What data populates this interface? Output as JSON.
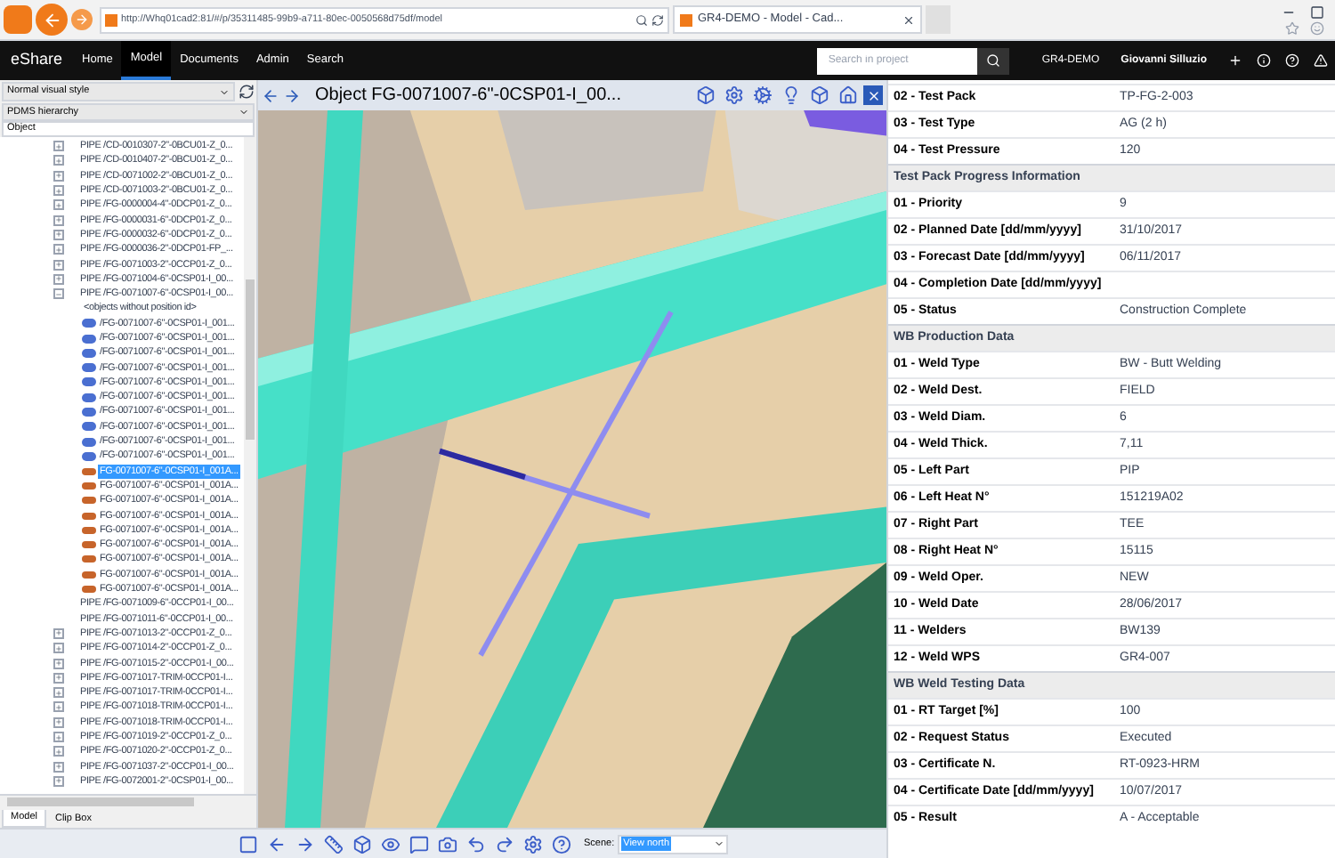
{
  "browser": {
    "url": "http://Whq01cad2:81/#/p/35311485-99b9-a711-80ec-0050568d75df/model",
    "tab_title": "GR4-DEMO - Model - Cad..."
  },
  "nav": {
    "brand": "eShare",
    "items": [
      {
        "label": "Home",
        "selected": false
      },
      {
        "label": "Model",
        "selected": true
      },
      {
        "label": "Documents",
        "selected": false
      },
      {
        "label": "Admin",
        "selected": false
      },
      {
        "label": "Search",
        "selected": false
      }
    ],
    "search": {
      "placeholder": "Search in project"
    },
    "project": "GR4-DEMO",
    "user": "Giovanni Silluzio"
  },
  "left_panel": {
    "visual_style": "Normal visual style",
    "hierarchy": "PDMS hierarchy",
    "column": "Object",
    "tree": [
      {
        "kind": "pipe",
        "label": "PIPE /CD-0010307-2\"-0BCU01-Z_0...",
        "expanded": false
      },
      {
        "kind": "pipe",
        "label": "PIPE /CD-0010407-2\"-0BCU01-Z_0...",
        "expanded": false
      },
      {
        "kind": "pipe",
        "label": "PIPE /CD-0071002-2\"-0BCU01-Z_0...",
        "expanded": false
      },
      {
        "kind": "pipe",
        "label": "PIPE /CD-0071003-2\"-0BCU01-Z_0...",
        "expanded": false
      },
      {
        "kind": "pipe",
        "label": "PIPE /FG-0000004-4\"-0DCP01-Z_0...",
        "expanded": false
      },
      {
        "kind": "pipe",
        "label": "PIPE /FG-0000031-6\"-0DCP01-Z_0...",
        "expanded": false
      },
      {
        "kind": "pipe",
        "label": "PIPE /FG-0000032-6\"-0DCP01-Z_0...",
        "expanded": false
      },
      {
        "kind": "pipe",
        "label": "PIPE /FG-0000036-2\"-0DCP01-FP_...",
        "expanded": false
      },
      {
        "kind": "pipe",
        "label": "PIPE /FG-0071003-2\"-0CCP01-Z_0...",
        "expanded": false
      },
      {
        "kind": "pipe",
        "label": "PIPE /FG-0071004-6\"-0CSP01-I_00...",
        "expanded": false
      },
      {
        "kind": "pipe",
        "label": "PIPE /FG-0071007-6\"-0CSP01-I_00...",
        "expanded": true,
        "children": [
          {
            "kind": "note",
            "label": "<objects without position id>",
            "selected": false
          },
          {
            "kind": "part",
            "label": "/FG-0071007-6\"-0CSP01-I_001...",
            "selected": false
          },
          {
            "kind": "part",
            "label": "/FG-0071007-6\"-0CSP01-I_001...",
            "selected": false
          },
          {
            "kind": "part",
            "label": "/FG-0071007-6\"-0CSP01-I_001...",
            "selected": false
          },
          {
            "kind": "part",
            "label": "/FG-0071007-6\"-0CSP01-I_001...",
            "selected": false
          },
          {
            "kind": "part",
            "label": "/FG-0071007-6\"-0CSP01-I_001...",
            "selected": false
          },
          {
            "kind": "part",
            "label": "/FG-0071007-6\"-0CSP01-I_001...",
            "selected": false
          },
          {
            "kind": "part",
            "label": "/FG-0071007-6\"-0CSP01-I_001...",
            "selected": false
          },
          {
            "kind": "part",
            "label": "/FG-0071007-6\"-0CSP01-I_001...",
            "selected": false
          },
          {
            "kind": "part",
            "label": "/FG-0071007-6\"-0CSP01-I_001...",
            "selected": false
          },
          {
            "kind": "part",
            "label": "/FG-0071007-6\"-0CSP01-I_001...",
            "selected": false
          },
          {
            "kind": "weld",
            "label": "FG-0071007-6\"-0CSP01-I_001A...",
            "selected": true
          },
          {
            "kind": "weld",
            "label": "FG-0071007-6\"-0CSP01-I_001A...",
            "selected": false
          },
          {
            "kind": "weld",
            "label": "FG-0071007-6\"-0CSP01-I_001A...",
            "selected": false
          },
          {
            "kind": "weld",
            "label": "FG-0071007-6\"-0CSP01-I_001A...",
            "selected": false
          },
          {
            "kind": "weld",
            "label": "FG-0071007-6\"-0CSP01-I_001A...",
            "selected": false
          },
          {
            "kind": "weld",
            "label": "FG-0071007-6\"-0CSP01-I_001A...",
            "selected": false
          },
          {
            "kind": "weld",
            "label": "FG-0071007-6\"-0CSP01-I_001A...",
            "selected": false
          },
          {
            "kind": "weld",
            "label": "FG-0071007-6\"-0CSP01-I_001A...",
            "selected": false
          },
          {
            "kind": "weld",
            "label": "FG-0071007-6\"-0CSP01-I_001A...",
            "selected": false
          }
        ]
      },
      {
        "kind": "plain",
        "label": "PIPE /FG-0071009-6\"-0CCP01-I_00..."
      },
      {
        "kind": "plain",
        "label": "PIPE /FG-0071011-6\"-0CCP01-I_00..."
      },
      {
        "kind": "pipe",
        "label": "PIPE /FG-0071013-2\"-0CCP01-Z_0...",
        "expanded": false
      },
      {
        "kind": "pipe",
        "label": "PIPE /FG-0071014-2\"-0CCP01-Z_0...",
        "expanded": false
      },
      {
        "kind": "pipe",
        "label": "PIPE /FG-0071015-2\"-0CCP01-I_00...",
        "expanded": false
      },
      {
        "kind": "pipe",
        "label": "PIPE /FG-0071017-TRIM-0CCP01-I...",
        "expanded": false
      },
      {
        "kind": "pipe",
        "label": "PIPE /FG-0071017-TRIM-0CCP01-I...",
        "expanded": false
      },
      {
        "kind": "pipe",
        "label": "PIPE /FG-0071018-TRIM-0CCP01-I...",
        "expanded": false
      },
      {
        "kind": "pipe",
        "label": "PIPE /FG-0071018-TRIM-0CCP01-I...",
        "expanded": false
      },
      {
        "kind": "pipe",
        "label": "PIPE /FG-0071019-2\"-0CCP01-Z_0...",
        "expanded": false
      },
      {
        "kind": "pipe",
        "label": "PIPE /FG-0071020-2\"-0CCP01-Z_0...",
        "expanded": false
      },
      {
        "kind": "pipe",
        "label": "PIPE /FG-0071037-2\"-0CCP01-I_00...",
        "expanded": false
      },
      {
        "kind": "pipe",
        "label": "PIPE /FG-0072001-2\"-0CSP01-I_00...",
        "expanded": false
      }
    ],
    "tabs": [
      {
        "label": "Model",
        "selected": true
      },
      {
        "label": "Clip Box",
        "selected": false
      }
    ]
  },
  "viewer": {
    "title": "Object FG-0071007-6\"-0CSP01-I_00...",
    "scene_label": "Scene:",
    "scene": "View north"
  },
  "properties": [
    {
      "kind": "row",
      "label": "02 - Test Pack",
      "value": "TP-FG-2-003"
    },
    {
      "kind": "row",
      "label": "03 - Test Type",
      "value": "AG (2 h)"
    },
    {
      "kind": "row",
      "label": "04 - Test Pressure",
      "value": "120"
    },
    {
      "kind": "header",
      "label": "Test Pack Progress Information"
    },
    {
      "kind": "row",
      "label": "01 - Priority",
      "value": "9"
    },
    {
      "kind": "row",
      "label": "02 - Planned Date [dd/mm/yyyy]",
      "value": "31/10/2017"
    },
    {
      "kind": "row",
      "label": "03 - Forecast Date [dd/mm/yyyy]",
      "value": "06/11/2017"
    },
    {
      "kind": "row",
      "label": "04 - Completion Date [dd/mm/yyyy]"
    },
    {
      "kind": "row",
      "label": "05 - Status",
      "value": "Construction Complete"
    },
    {
      "kind": "header",
      "label": "WB Production Data"
    },
    {
      "kind": "row",
      "label": "01 - Weld Type",
      "value": "BW - Butt Welding"
    },
    {
      "kind": "row",
      "label": "02 - Weld Dest.",
      "value": "FIELD"
    },
    {
      "kind": "row",
      "label": "03 - Weld Diam.",
      "value": "6"
    },
    {
      "kind": "row",
      "label": "04 - Weld Thick.",
      "value": "7,11"
    },
    {
      "kind": "row",
      "label": "05 - Left Part",
      "value": "PIP"
    },
    {
      "kind": "row",
      "label": "06 - Left Heat N°",
      "value": "151219A02"
    },
    {
      "kind": "row",
      "label": "07 - Right Part",
      "value": "TEE"
    },
    {
      "kind": "row",
      "label": "08 - Right Heat N°",
      "value": "15115"
    },
    {
      "kind": "row",
      "label": "09 - Weld Oper.",
      "value": "NEW"
    },
    {
      "kind": "row",
      "label": "10 - Weld Date",
      "value": "28/06/2017"
    },
    {
      "kind": "row",
      "label": "11 - Welders",
      "value": "BW139"
    },
    {
      "kind": "row",
      "label": "12 - Weld WPS",
      "value": "GR4-007"
    },
    {
      "kind": "header",
      "label": "WB Weld Testing Data"
    },
    {
      "kind": "row",
      "label": "01 - RT Target [%]",
      "value": "100"
    },
    {
      "kind": "row",
      "label": "02 - Request Status",
      "value": "Executed"
    },
    {
      "kind": "row",
      "label": "03 - Certificate N.",
      "value": "RT-0923-HRM"
    },
    {
      "kind": "row",
      "label": "04 - Certificate Date [dd/mm/yyyy]",
      "value": "10/07/2017"
    },
    {
      "kind": "row",
      "label": "05 - Result",
      "value": "A - Acceptable"
    }
  ]
}
